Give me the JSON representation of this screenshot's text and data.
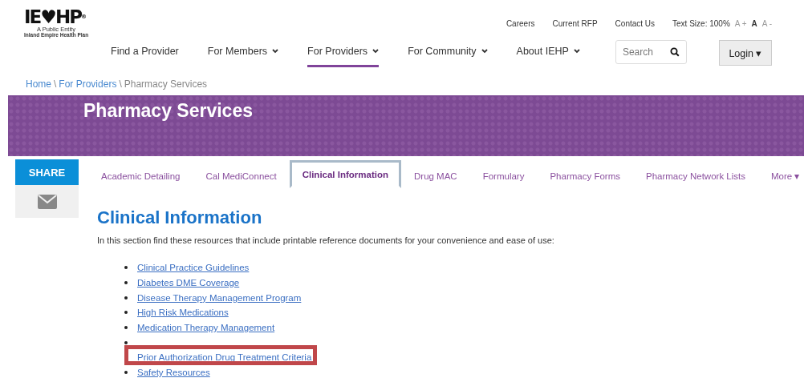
{
  "logo": {
    "mark": "IE♥HP",
    "registered": "®",
    "tagline": "A Public Entity",
    "name": "Inland Empire Health Plan"
  },
  "utility_links": [
    "Careers",
    "Current RFP",
    "Contact Us"
  ],
  "text_size": {
    "label": "Text Size: 100%",
    "options": [
      {
        "label": "A +",
        "selected": false
      },
      {
        "label": "A",
        "selected": true
      },
      {
        "label": "A -",
        "selected": false
      }
    ]
  },
  "nav": [
    {
      "label": "Find a Provider",
      "dropdown": false,
      "selected": false
    },
    {
      "label": "For Members",
      "dropdown": true,
      "selected": false
    },
    {
      "label": "For Providers",
      "dropdown": true,
      "selected": true
    },
    {
      "label": "For Community",
      "dropdown": true,
      "selected": false
    },
    {
      "label": "About IEHP",
      "dropdown": true,
      "selected": false
    }
  ],
  "search": {
    "placeholder": "Search"
  },
  "login": {
    "label": "Login ▾"
  },
  "breadcrumb": [
    {
      "label": "Home",
      "link": true
    },
    {
      "separator": "\\",
      "label": "For Providers",
      "link": true
    },
    {
      "separator": "\\",
      "label": "Pharmacy Services",
      "link": false
    }
  ],
  "banner": {
    "title": "Pharmacy Services"
  },
  "share": {
    "label": "SHARE"
  },
  "tabs": [
    {
      "label": "Academic Detailing",
      "selected": false
    },
    {
      "label": "Cal MediConnect",
      "selected": false
    },
    {
      "label": "Clinical Information",
      "selected": true
    },
    {
      "label": "Drug MAC",
      "selected": false
    },
    {
      "label": "Formulary",
      "selected": false
    },
    {
      "label": "Pharmacy Forms",
      "selected": false
    },
    {
      "label": "Pharmacy Network Lists",
      "selected": false
    },
    {
      "label": "More ▾",
      "selected": false
    }
  ],
  "content": {
    "heading": "Clinical Information",
    "intro": "In this section find these resources that include printable reference documents for your convenience and ease of use:",
    "links": [
      {
        "kind": "link",
        "label": "Clinical Practice Guidelines",
        "highlighted": false
      },
      {
        "kind": "link",
        "label": "Diabetes DME Coverage",
        "highlighted": false
      },
      {
        "kind": "link",
        "label": "Disease Therapy Management Program",
        "highlighted": false
      },
      {
        "kind": "link",
        "label": "High Risk Medications",
        "highlighted": false
      },
      {
        "kind": "link",
        "label": "Medication Therapy Management",
        "highlighted": false
      },
      {
        "kind": "covered"
      },
      {
        "kind": "link",
        "label": "Prior Authorization Drug Treatment Criteria",
        "highlighted": true
      },
      {
        "kind": "link",
        "label": "Safety Resources",
        "highlighted": false
      }
    ]
  }
}
